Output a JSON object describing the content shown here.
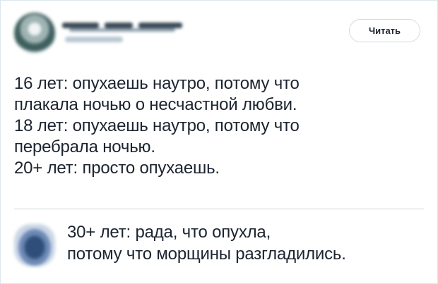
{
  "header": {
    "follow_label": "Читать"
  },
  "tweet": {
    "lines": [
      "16 лет: опухаешь наутро, потому что",
      "плакала ночью о несчастной любви.",
      "18 лет: опухаешь наутро, потому что",
      "перебрала ночью.",
      "20+ лет: просто опухаешь."
    ]
  },
  "reply": {
    "lines": [
      "30+ лет: рада, что опухла,",
      "потому что морщины разгладились."
    ]
  }
}
